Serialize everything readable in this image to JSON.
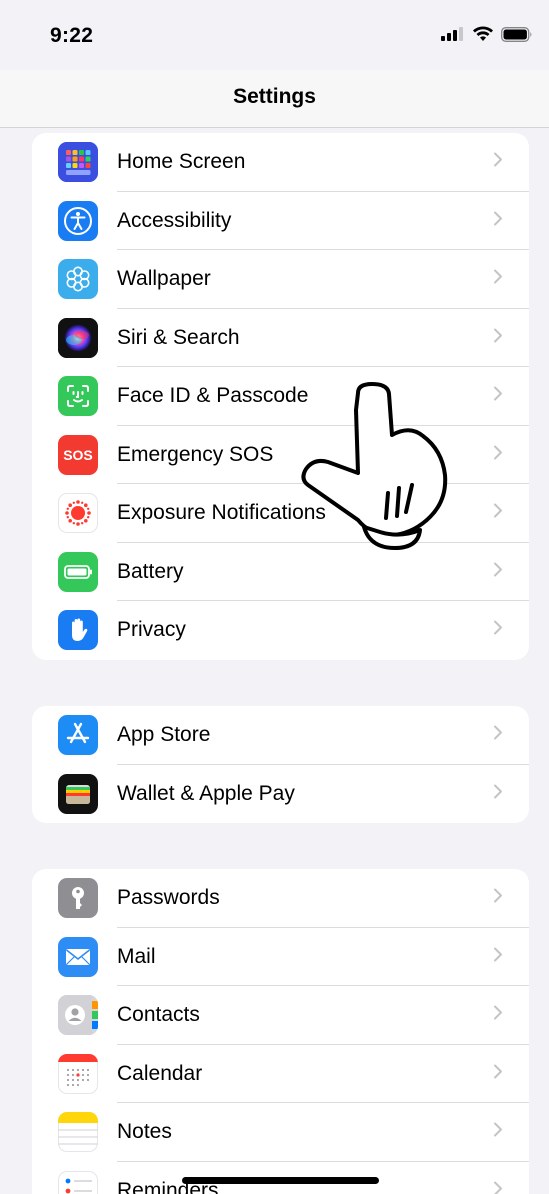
{
  "status_bar": {
    "time": "9:22"
  },
  "nav": {
    "title": "Settings"
  },
  "groups": [
    {
      "items": [
        {
          "label": "Home Screen",
          "icon": "home-screen-icon",
          "color": "#3a4fe0"
        },
        {
          "label": "Accessibility",
          "icon": "accessibility-icon",
          "color": "#1a7cf2"
        },
        {
          "label": "Wallpaper",
          "icon": "wallpaper-icon",
          "color": "#3cadec"
        },
        {
          "label": "Siri & Search",
          "icon": "siri-icon",
          "color": "#1a1a2e"
        },
        {
          "label": "Face ID & Passcode",
          "icon": "face-id-icon",
          "color": "#34c759"
        },
        {
          "label": "Emergency SOS",
          "icon": "sos-icon",
          "icon_text": "SOS",
          "color": "#f23a30"
        },
        {
          "label": "Exposure Notifications",
          "icon": "exposure-notifications-icon",
          "color": "#ffffff"
        },
        {
          "label": "Battery",
          "icon": "battery-icon",
          "color": "#34c759"
        },
        {
          "label": "Privacy",
          "icon": "privacy-hand-icon",
          "color": "#1a7cf2"
        }
      ]
    },
    {
      "items": [
        {
          "label": "App Store",
          "icon": "app-store-icon",
          "color": "#1e8cf5"
        },
        {
          "label": "Wallet & Apple Pay",
          "icon": "wallet-icon",
          "color": "#111111"
        }
      ]
    },
    {
      "items": [
        {
          "label": "Passwords",
          "icon": "key-icon",
          "color": "#8e8e93"
        },
        {
          "label": "Mail",
          "icon": "mail-icon",
          "color": "#2e8cf5"
        },
        {
          "label": "Contacts",
          "icon": "contacts-icon",
          "color": "#c9c9ce"
        },
        {
          "label": "Calendar",
          "icon": "calendar-icon",
          "color": "#ffffff"
        },
        {
          "label": "Notes",
          "icon": "notes-icon",
          "color": "#ffffff"
        },
        {
          "label": "Reminders",
          "icon": "reminders-icon",
          "color": "#ffffff"
        }
      ]
    }
  ]
}
